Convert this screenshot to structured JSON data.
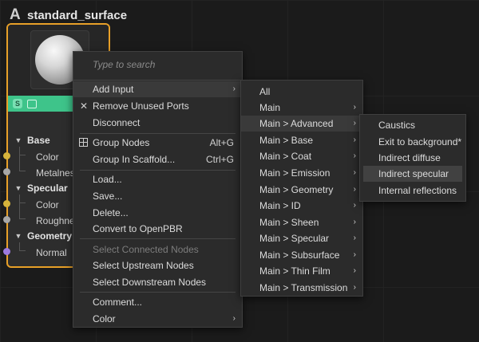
{
  "node": {
    "logo": "A",
    "title": "standard_surface",
    "groups": [
      {
        "label": "Base",
        "ports": [
          "Color",
          "Metalness"
        ]
      },
      {
        "label": "Specular",
        "ports": [
          "Color",
          "Roughness"
        ]
      },
      {
        "label": "Geometry",
        "ports": [
          "Normal"
        ]
      }
    ],
    "iconbar": {
      "shader_icon": "S"
    }
  },
  "context_menu": {
    "search_placeholder": "Type to search",
    "items": [
      {
        "label": "Add Input",
        "submenu": true
      },
      {
        "label": "Remove Unused Ports",
        "icon": "✕"
      },
      {
        "label": "Disconnect"
      },
      {
        "label": "Group Nodes",
        "shortcut": "Alt+G"
      },
      {
        "label": "Group In Scaffold...",
        "shortcut": "Ctrl+G"
      },
      {
        "label": "Load..."
      },
      {
        "label": "Save..."
      },
      {
        "label": "Delete..."
      },
      {
        "label": "Convert to OpenPBR"
      },
      {
        "label": "Select Connected Nodes",
        "disabled": true
      },
      {
        "label": "Select Upstream Nodes"
      },
      {
        "label": "Select Downstream Nodes"
      },
      {
        "label": "Comment..."
      },
      {
        "label": "Color",
        "submenu": true
      }
    ]
  },
  "add_input_menu": {
    "items": [
      "All",
      "Main",
      "Main > Advanced",
      "Main > Base",
      "Main > Coat",
      "Main > Emission",
      "Main > Geometry",
      "Main > ID",
      "Main > Sheen",
      "Main > Specular",
      "Main > Subsurface",
      "Main > Thin Film",
      "Main > Transmission"
    ]
  },
  "advanced_menu": {
    "items": [
      "Caustics",
      "Exit to background*",
      "Indirect diffuse",
      "Indirect specular",
      "Internal reflections"
    ]
  },
  "arrow_glyph": "›"
}
